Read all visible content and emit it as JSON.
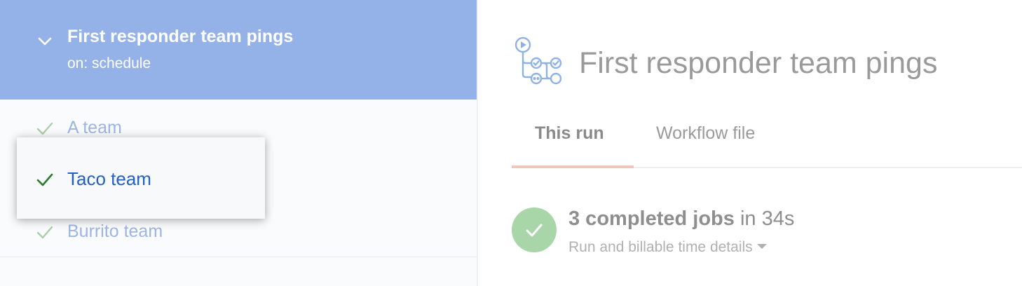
{
  "sidebar": {
    "workflow": {
      "title": "First responder team pings",
      "trigger": "on: schedule",
      "expand_icon": "chevron-down-icon"
    },
    "jobs": [
      {
        "label": "A team",
        "status": "success",
        "icon": "check-icon"
      },
      {
        "label": "Taco team",
        "status": "success",
        "icon": "check-icon",
        "selected": true
      },
      {
        "label": "Burrito team",
        "status": "success",
        "icon": "check-icon"
      }
    ]
  },
  "main": {
    "title": "First responder team pings",
    "icon": "workflow-graph-icon",
    "tabs": [
      {
        "label": "This run",
        "active": true
      },
      {
        "label": "Workflow file",
        "active": false
      }
    ],
    "summary": {
      "jobs_strong": "3 completed jobs",
      "duration_text": " in 34s",
      "details_label": "Run and billable time details",
      "status_icon": "check-circle-icon"
    }
  },
  "colors": {
    "header_bg": "#94b2e8",
    "job_link": "#9db4e4",
    "selected_link": "#2160c4",
    "success_check": "#2c7a2c",
    "success_circle": "#a8d6a8",
    "tab_underline": "#f2c6bb"
  }
}
